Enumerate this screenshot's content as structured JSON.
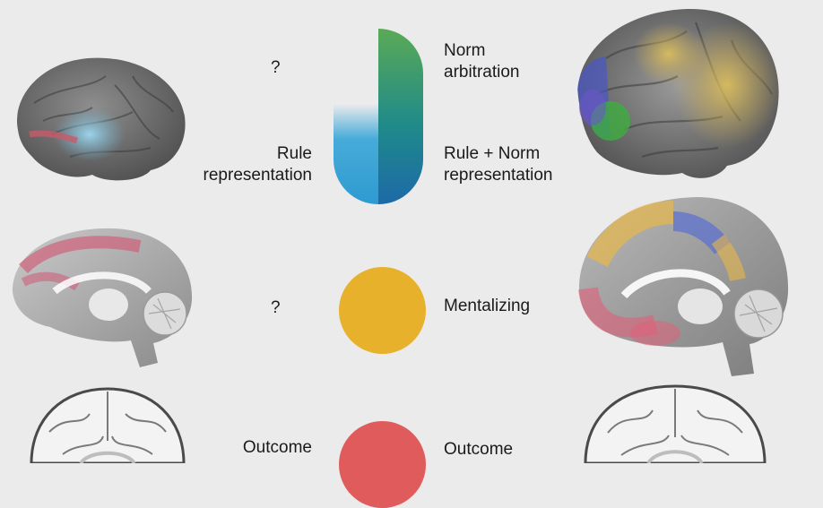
{
  "rows": [
    {
      "left_label": "?",
      "left_sub_label": "Rule\nrepresentation",
      "right_top_label": "Norm\narbitration",
      "right_bottom_label": "Rule + Norm\nrepresentation",
      "symbol": "split-pill",
      "colors": {
        "green": "#5aaa55",
        "teal": "#1f8a8a",
        "dark_blue": "#1d6aa8",
        "light_blue": "#3ea8d8"
      }
    },
    {
      "left_label": "?",
      "right_label": "Mentalizing",
      "symbol": "circle",
      "color": "#e8b12c"
    },
    {
      "left_label": "Outcome",
      "right_label": "Outcome",
      "symbol": "circle",
      "color": "#e05b5b"
    }
  ]
}
